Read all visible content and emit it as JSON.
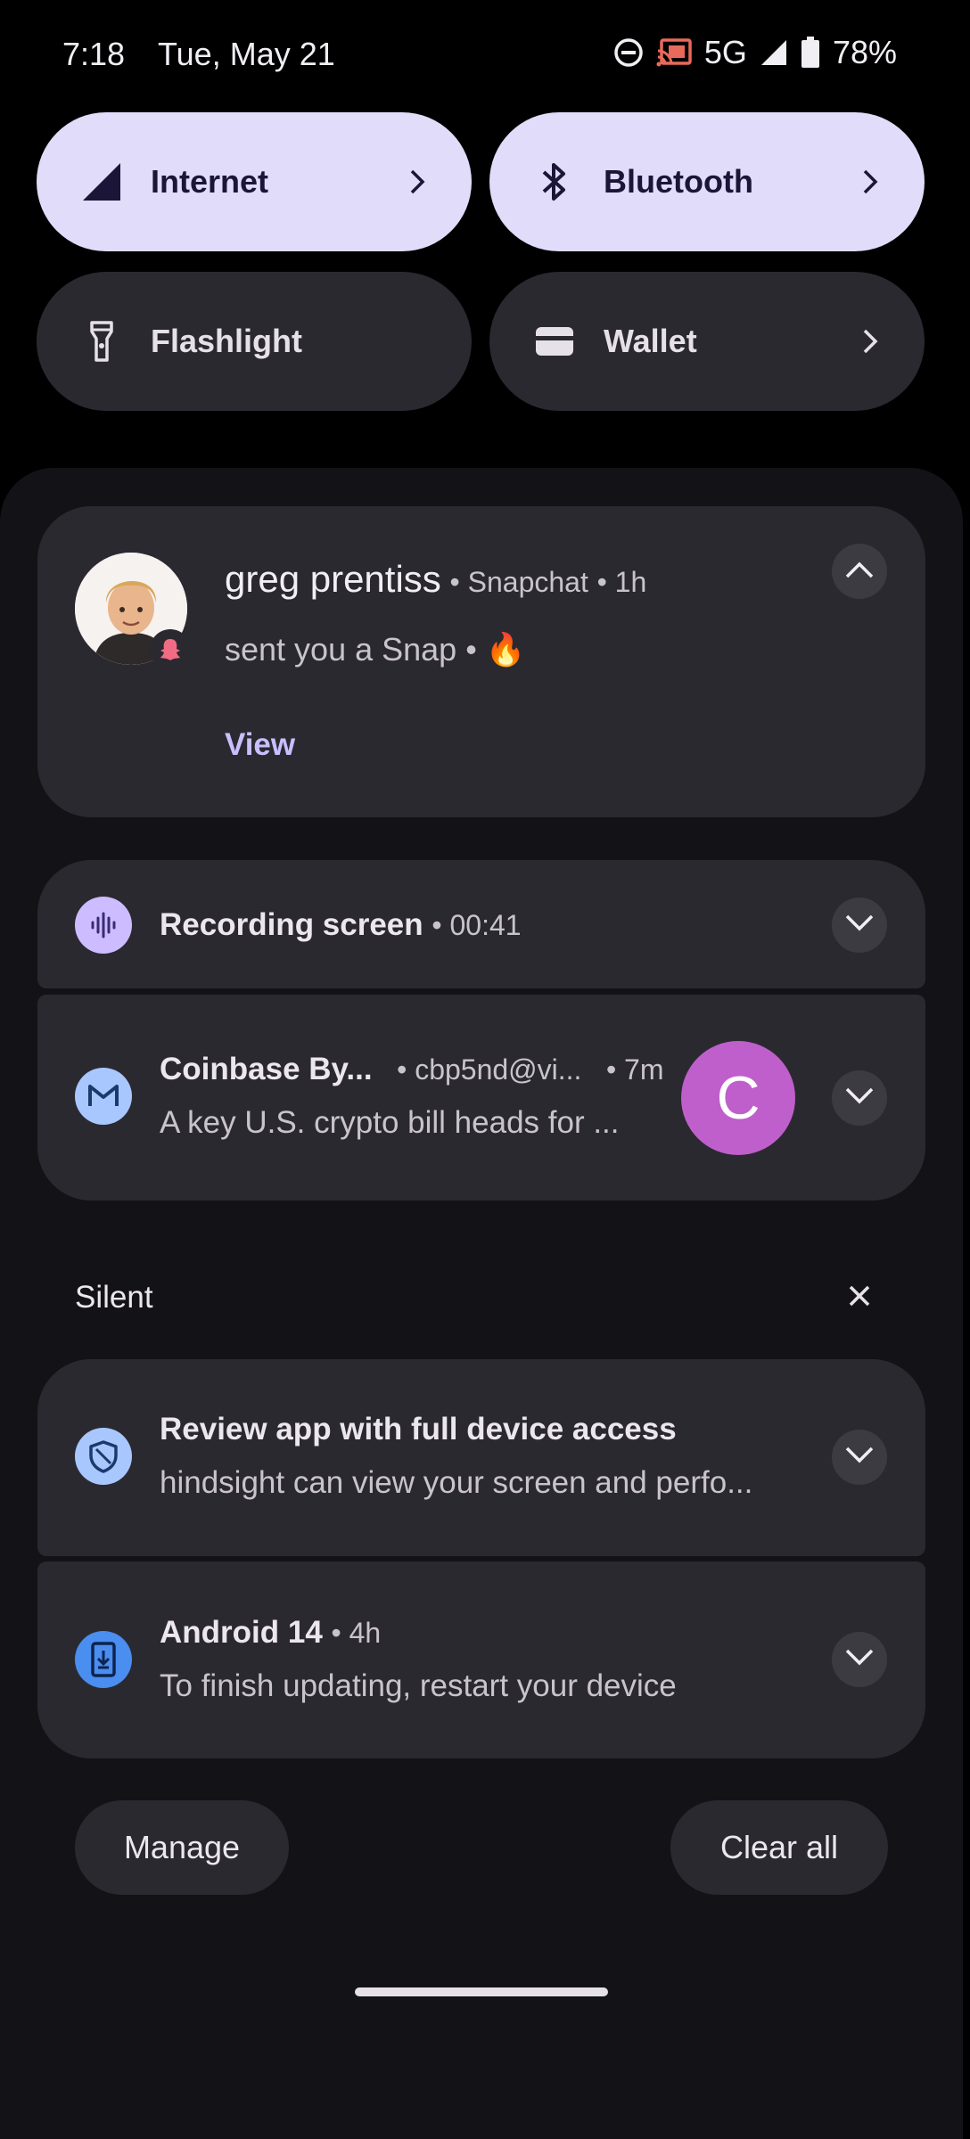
{
  "status_bar": {
    "time": "7:18",
    "date": "Tue, May 21",
    "network": "5G",
    "battery": "78%",
    "icons": [
      "do-not-disturb-icon",
      "cast-icon",
      "signal-icon",
      "battery-icon"
    ]
  },
  "quick_tiles": [
    {
      "label": "Internet",
      "icon": "signal-icon",
      "active": true,
      "has_chevron": true
    },
    {
      "label": "Bluetooth",
      "icon": "bluetooth-icon",
      "active": true,
      "has_chevron": true
    },
    {
      "label": "Flashlight",
      "icon": "flashlight-icon",
      "active": false,
      "has_chevron": false
    },
    {
      "label": "Wallet",
      "icon": "wallet-icon",
      "active": false,
      "has_chevron": true
    }
  ],
  "notifications": {
    "snapchat": {
      "sender": "greg prentiss",
      "app": "Snapchat",
      "time": "1h",
      "message": "sent you a Snap",
      "emoji": "🔥",
      "action": "View"
    },
    "recording": {
      "title": "Recording screen",
      "elapsed": "00:41"
    },
    "email": {
      "title": "Coinbase By...",
      "account": "cbp5nd@vi...",
      "time": "7m",
      "preview": "A key U.S. crypto bill heads for ...",
      "avatar_letter": "C"
    }
  },
  "silent_section": {
    "header": "Silent",
    "items": [
      {
        "title": "Review app with full device access",
        "body": "hindsight can view your screen and perfo..."
      },
      {
        "title": "Android 14",
        "time": "4h",
        "body": "To finish updating, restart your device"
      }
    ]
  },
  "footer": {
    "manage_label": "Manage",
    "clear_all_label": "Clear all"
  },
  "colors": {
    "tile_active": "#e0dcfa",
    "tile_inactive": "#2b2930",
    "card": "#2b2930",
    "shade": "#131217",
    "accent": "#c8bfff",
    "avatar_purple": "#bf5fcb",
    "update_blue": "#4a8ef0"
  }
}
